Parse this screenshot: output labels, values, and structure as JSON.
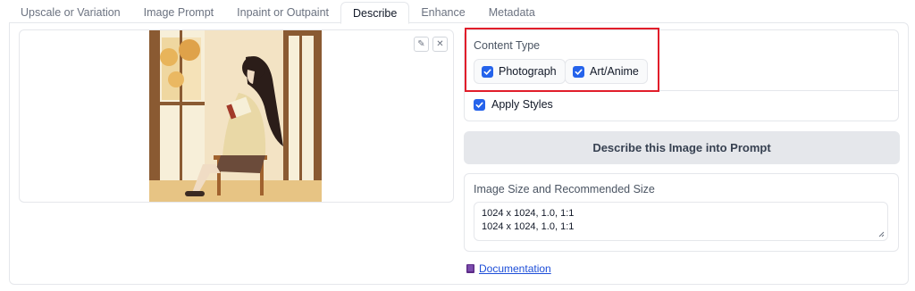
{
  "tabs": [
    {
      "label": "Upscale or Variation",
      "active": false
    },
    {
      "label": "Image Prompt",
      "active": false
    },
    {
      "label": "Inpaint or Outpaint",
      "active": false
    },
    {
      "label": "Describe",
      "active": true
    },
    {
      "label": "Enhance",
      "active": false
    },
    {
      "label": "Metadata",
      "active": false
    }
  ],
  "image_panel": {
    "edit_icon": "pencil-icon",
    "clear_icon": "close-icon",
    "edit_glyph": "✎",
    "clear_glyph": "✕"
  },
  "content_type": {
    "label": "Content Type",
    "options": [
      {
        "label": "Photograph",
        "checked": true
      },
      {
        "label": "Art/Anime",
        "checked": true
      }
    ],
    "apply_styles": {
      "label": "Apply Styles",
      "checked": true
    }
  },
  "describe_button": {
    "label": "Describe this Image into Prompt"
  },
  "image_size": {
    "label": "Image Size and Recommended Size",
    "lines": [
      "1024 x 1024, 1.0, 1:1",
      "1024 x 1024, 1.0, 1:1"
    ]
  },
  "documentation": {
    "label": "Documentation",
    "icon": "book-icon"
  },
  "colors": {
    "accent": "#2563eb",
    "highlight": "#e11d2a",
    "link": "#1d4ed8"
  }
}
